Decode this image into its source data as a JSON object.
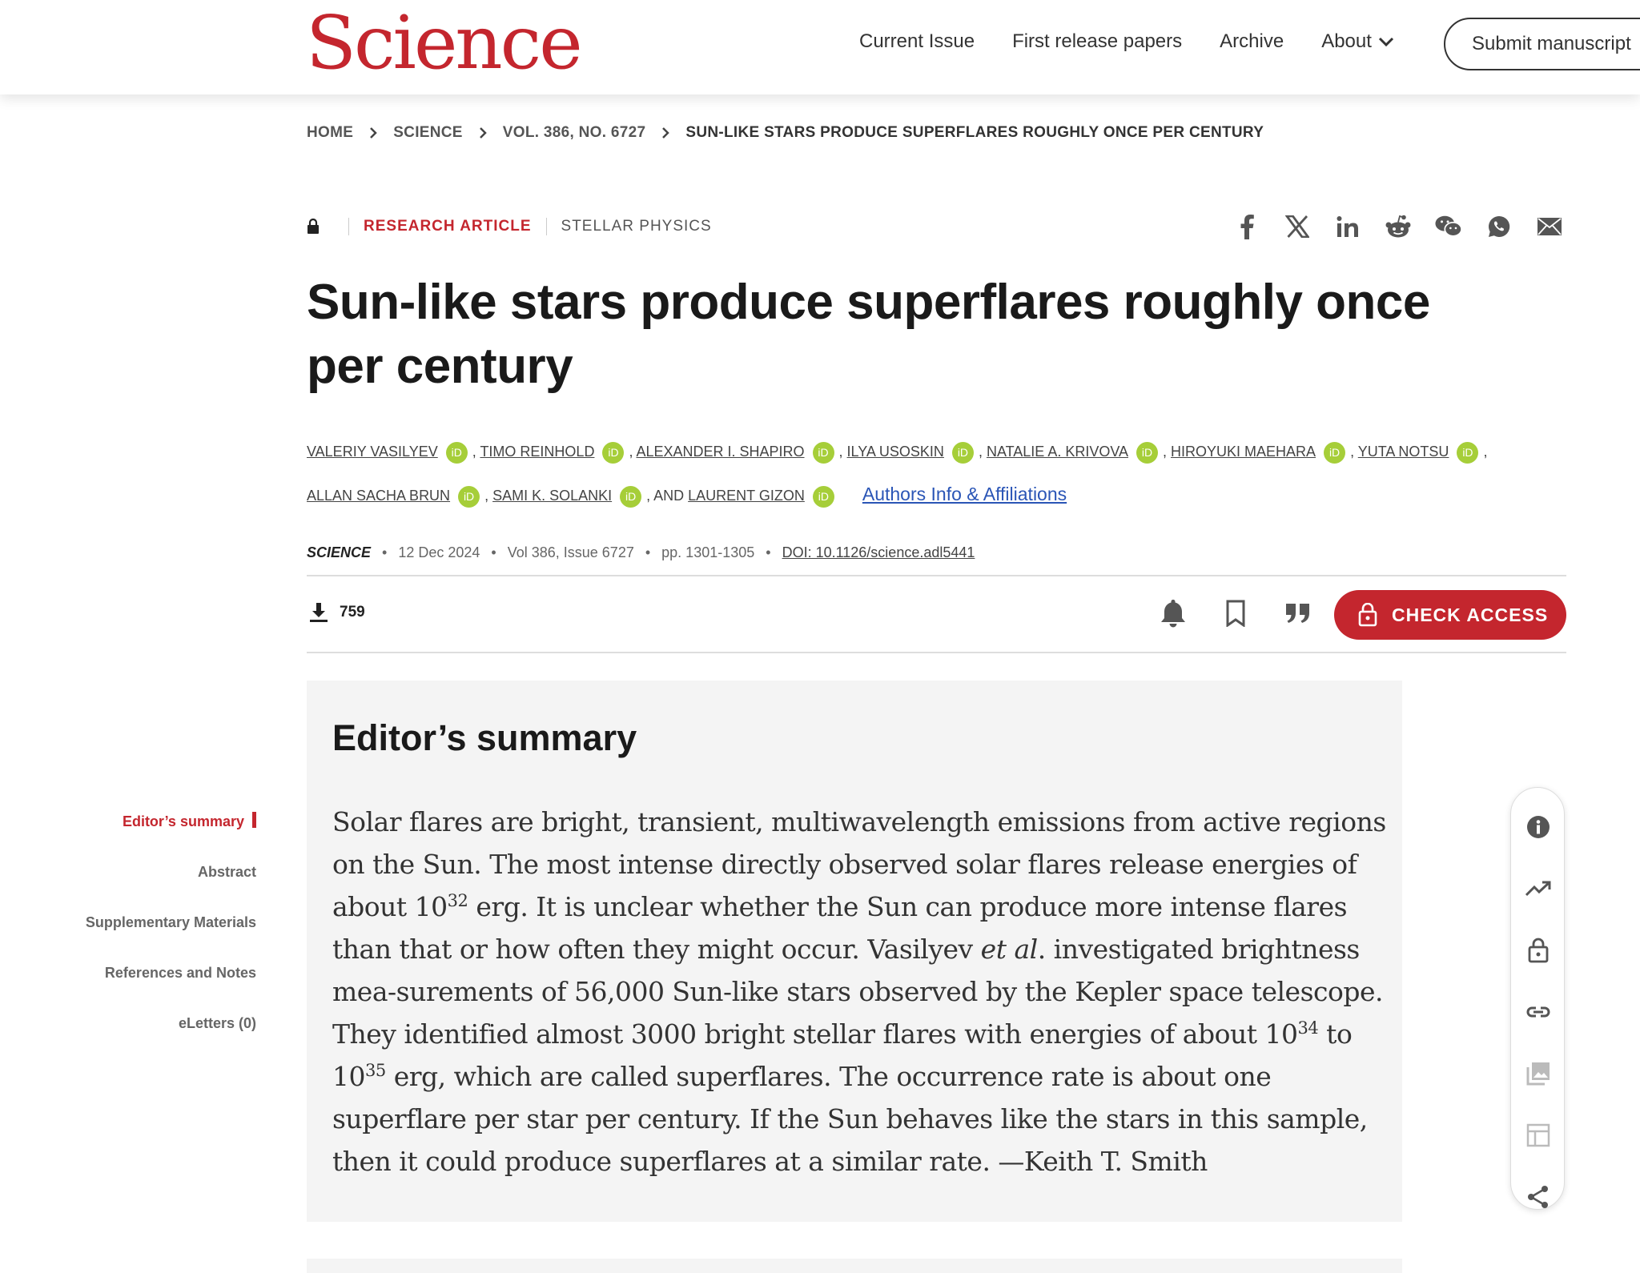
{
  "header": {
    "logo": "Science",
    "nav": [
      "Current Issue",
      "First release papers",
      "Archive",
      "About"
    ],
    "submit_label": "Submit manuscript"
  },
  "breadcrumb": [
    "HOME",
    "SCIENCE",
    "VOL. 386, NO. 6727",
    "SUN-LIKE STARS PRODUCE SUPERFLARES ROUGHLY ONCE PER CENTURY"
  ],
  "article": {
    "type": "RESEARCH ARTICLE",
    "subject": "STELLAR PHYSICS",
    "title": "Sun-like stars produce superflares roughly once per century",
    "authors": [
      "VALERIY VASILYEV",
      "TIMO REINHOLD",
      "ALEXANDER I. SHAPIRO",
      "ILYA USOSKIN",
      "NATALIE A. KRIVOVA",
      "HIROYUKI MAEHARA",
      "YUTA NOTSU",
      "ALLAN SACHA BRUN",
      "SAMI K. SOLANKI",
      "LAURENT GIZON"
    ],
    "and_label": ", AND",
    "affiliations_link": "Authors Info & Affiliations",
    "journal": "SCIENCE",
    "date": "12 Dec 2024",
    "volume": "Vol 386, Issue 6727",
    "pages": "pp. 1301-1305",
    "doi": "DOI: 10.1126/science.adl5441",
    "downloads": "759",
    "check_access": "CHECK ACCESS"
  },
  "share_icons": [
    "facebook-icon",
    "x-icon",
    "linkedin-icon",
    "reddit-icon",
    "wechat-icon",
    "whatsapp-icon",
    "email-icon"
  ],
  "toc": [
    "Editor’s summary",
    "Abstract",
    "Supplementary Materials",
    "References and Notes",
    "eLetters (0)"
  ],
  "summary": {
    "heading": "Editor’s summary",
    "p1": "Solar flares are bright, transient, multiwavelength emissions from active regions on the Sun. The most intense directly observed solar flares release energies of about 10",
    "exp1": "32",
    "p2": " erg. It is unclear whether the Sun can produce more intense flares than that or how often they might occur. Vasilyev ",
    "etal": "et al",
    "p3": ". investigated brightness mea-surements of 56,000 Sun-like stars observed by the Kepler space telescope. They identified almost 3000 bright stellar flares with energies of about 10",
    "exp2": "34",
    "p4": " to 10",
    "exp3": "35",
    "p5": " erg, which are called superflares. The occurrence rate is about one superflare per star per century. If the Sun behaves like the stars in this sample, then it could produce superflares at a similar rate. —Keith T. Smith"
  },
  "colors": {
    "brand": "#c4262e",
    "orcid": "#a6ce39",
    "link": "#2a55b6"
  }
}
